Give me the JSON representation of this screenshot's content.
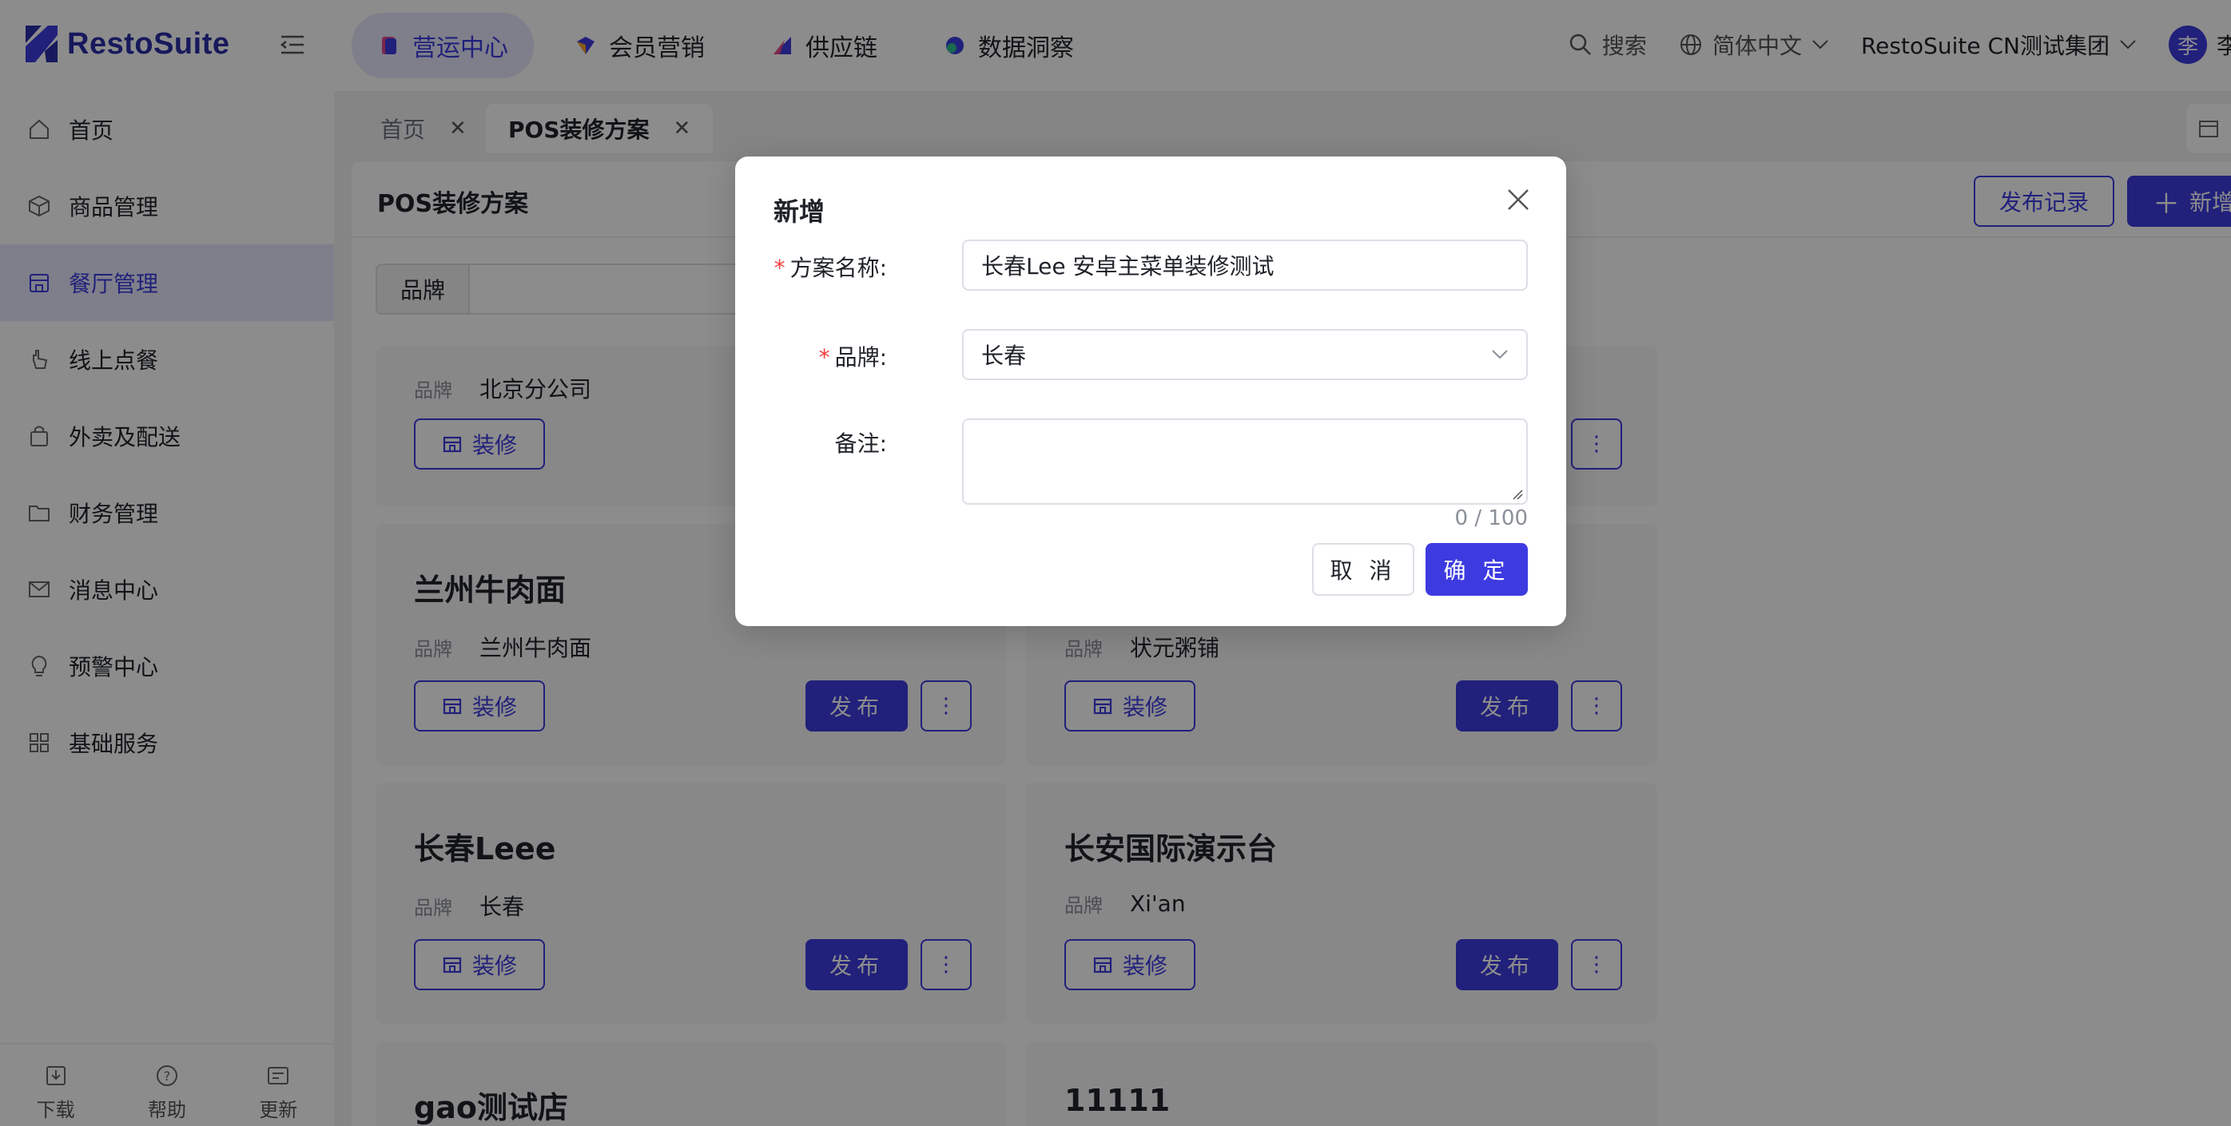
{
  "header": {
    "logo_text": "RestoSuite",
    "nav": [
      {
        "label": "营运中心",
        "active": true
      },
      {
        "label": "会员营销",
        "active": false
      },
      {
        "label": "供应链",
        "active": false
      },
      {
        "label": "数据洞察",
        "active": false
      }
    ],
    "search_label": "搜索",
    "language": "简体中文",
    "org": "RestoSuite CN测试集团",
    "avatar_initial": "李",
    "user_name": "李"
  },
  "sidebar": {
    "items": [
      {
        "label": "首页",
        "icon": "home-icon"
      },
      {
        "label": "商品管理",
        "icon": "box-icon"
      },
      {
        "label": "餐厅管理",
        "icon": "store-icon",
        "active": true
      },
      {
        "label": "线上点餐",
        "icon": "hand-icon"
      },
      {
        "label": "外卖及配送",
        "icon": "bag-icon"
      },
      {
        "label": "财务管理",
        "icon": "folder-icon"
      },
      {
        "label": "消息中心",
        "icon": "mail-icon"
      },
      {
        "label": "预警中心",
        "icon": "bulb-icon"
      },
      {
        "label": "基础服务",
        "icon": "grid-icon"
      }
    ],
    "bottom": [
      "下载",
      "帮助",
      "更新"
    ]
  },
  "tabs": [
    {
      "label": "首页",
      "active": false
    },
    {
      "label": "POS装修方案",
      "active": true
    }
  ],
  "panel": {
    "title": "POS装修方案",
    "record_button": "发布记录",
    "add_button": "新增",
    "filter_label": "品牌"
  },
  "card_labels": {
    "brand_label": "品牌",
    "decorate": "装修",
    "publish": "发布"
  },
  "cards": [
    {
      "title": "",
      "brand": "北京分公司"
    },
    {
      "title": "",
      "brand": ""
    },
    {
      "title": "兰州牛肉面",
      "brand": "兰州牛肉面"
    },
    {
      "title": "",
      "brand": "状元粥铺"
    },
    {
      "title": "长春Leee",
      "brand": "长春"
    },
    {
      "title": "长安国际演示台",
      "brand": "Xi'an"
    },
    {
      "title": "gao测试店",
      "brand": ""
    },
    {
      "title": "11111",
      "brand": ""
    }
  ],
  "modal": {
    "title": "新增",
    "name_label": "方案名称:",
    "name_value": "长春Lee 安卓主菜单装修测试",
    "brand_label": "品牌:",
    "brand_value": "长春",
    "remark_label": "备注:",
    "counter": "0 / 100",
    "cancel": "取 消",
    "ok": "确 定"
  },
  "colors": {
    "primary": "#3d3be0",
    "active_bg": "#e6e8fb",
    "required": "#f53f3f"
  }
}
